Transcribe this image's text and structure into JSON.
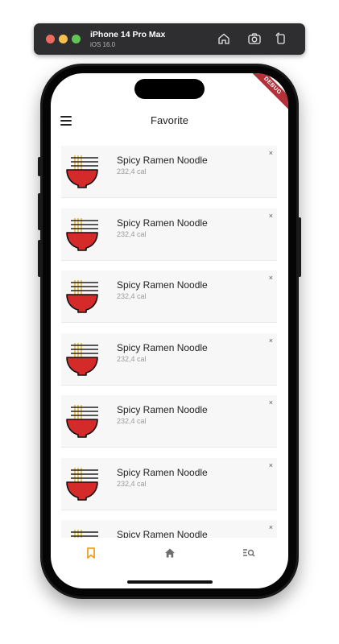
{
  "simulator": {
    "device_name": "iPhone 14 Pro Max",
    "os_version": "iOS 16.0",
    "buttons": [
      "home-icon",
      "screenshot-icon",
      "rotate-icon"
    ]
  },
  "app": {
    "debug_banner": "DEBUG",
    "title": "Favorite",
    "favorites": [
      {
        "name": "Spicy Ramen Noodle",
        "calories": "232,4 cal",
        "remove": "×"
      },
      {
        "name": "Spicy Ramen Noodle",
        "calories": "232,4 cal",
        "remove": "×"
      },
      {
        "name": "Spicy Ramen Noodle",
        "calories": "232,4 cal",
        "remove": "×"
      },
      {
        "name": "Spicy Ramen Noodle",
        "calories": "232,4 cal",
        "remove": "×"
      },
      {
        "name": "Spicy Ramen Noodle",
        "calories": "232,4 cal",
        "remove": "×"
      },
      {
        "name": "Spicy Ramen Noodle",
        "calories": "232,4 cal",
        "remove": "×"
      },
      {
        "name": "Spicy Ramen Noodle",
        "calories": "",
        "remove": "×"
      }
    ],
    "bottom_nav": [
      {
        "icon": "bookmark-icon",
        "active": true
      },
      {
        "icon": "home-icon",
        "active": false
      },
      {
        "icon": "search-list-icon",
        "active": false
      }
    ],
    "colors": {
      "accent": "#f0a020",
      "bowl_red": "#d42a2a",
      "noodle_yellow": "#e8b93a"
    }
  }
}
